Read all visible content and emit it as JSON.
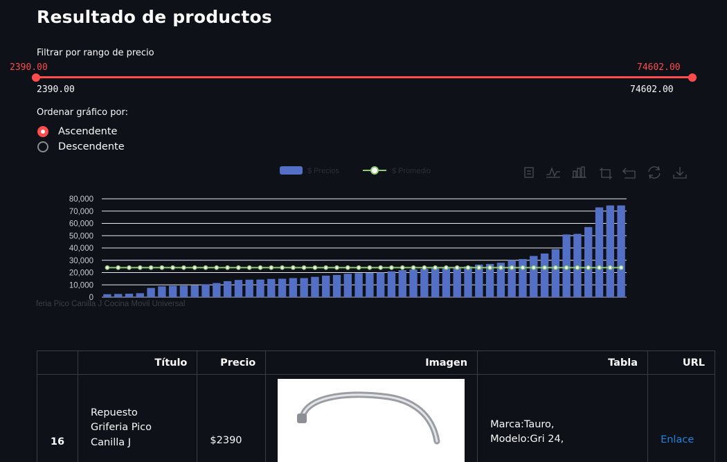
{
  "page": {
    "title": "Resultado de productos"
  },
  "price_filter": {
    "label": "Filtrar por rango de precio",
    "min": "2390.00",
    "max": "74602.00",
    "selected_low": "2390.00",
    "selected_high": "74602.00"
  },
  "sort": {
    "label": "Ordenar gráfico por:",
    "options": [
      "Ascendente",
      "Descendente"
    ],
    "selected": "Ascendente"
  },
  "chart": {
    "toolbar_icons": [
      "data-view-icon",
      "line-chart-icon",
      "bar-chart-icon",
      "zoom-icon",
      "zoom-reset-icon",
      "restore-icon",
      "download-icon"
    ],
    "xlabel_visible": "feria Pico Canilla J Cocina Movil Universal"
  },
  "chart_data": {
    "type": "bar",
    "legend_position": "top-center",
    "grid": true,
    "ylim": [
      0,
      80000
    ],
    "yticks": [
      "0",
      "10,000",
      "20,000",
      "30,000",
      "40,000",
      "50,000",
      "60,000",
      "70,000",
      "80,000"
    ],
    "series": [
      {
        "name": "$ Precios",
        "color": "#5470c6",
        "values": [
          2390,
          2600,
          2800,
          3200,
          7500,
          8800,
          9200,
          9300,
          9500,
          10500,
          11500,
          13000,
          14000,
          14200,
          14300,
          14800,
          15000,
          15500,
          15500,
          16500,
          17500,
          18000,
          19000,
          19500,
          19800,
          20000,
          21000,
          22000,
          22500,
          23000,
          23500,
          24000,
          24500,
          25000,
          26500,
          27000,
          28000,
          30000,
          31000,
          33500,
          35500,
          39000,
          51000,
          51500,
          57000,
          73000,
          74602,
          74602
        ]
      },
      {
        "name": "$ Promedio",
        "color": "#91cc75",
        "values": [
          24000,
          24000,
          24000,
          24000,
          24000,
          24000,
          24000,
          24000,
          24000,
          24000,
          24000,
          24000,
          24000,
          24000,
          24000,
          24000,
          24000,
          24000,
          24000,
          24000,
          24000,
          24000,
          24000,
          24000,
          24000,
          24000,
          24000,
          24000,
          24000,
          24000,
          24000,
          24000,
          24000,
          24000,
          24000,
          24000,
          24000,
          24000,
          24000,
          24000,
          24000,
          24000,
          24000,
          24000,
          24000,
          24000,
          24000,
          24000
        ]
      }
    ]
  },
  "table": {
    "headers": [
      "",
      "Título",
      "Precio",
      "Imagen",
      "Tabla",
      "URL"
    ],
    "rows": [
      {
        "index": "16",
        "title_lines": [
          "Repuesto",
          "Griferia Pico",
          "Canilla J"
        ],
        "price": "$2390",
        "tabla_lines": [
          "Marca:Tauro,",
          "Modelo:Gri 24,"
        ],
        "url_text": "Enlace"
      }
    ]
  }
}
